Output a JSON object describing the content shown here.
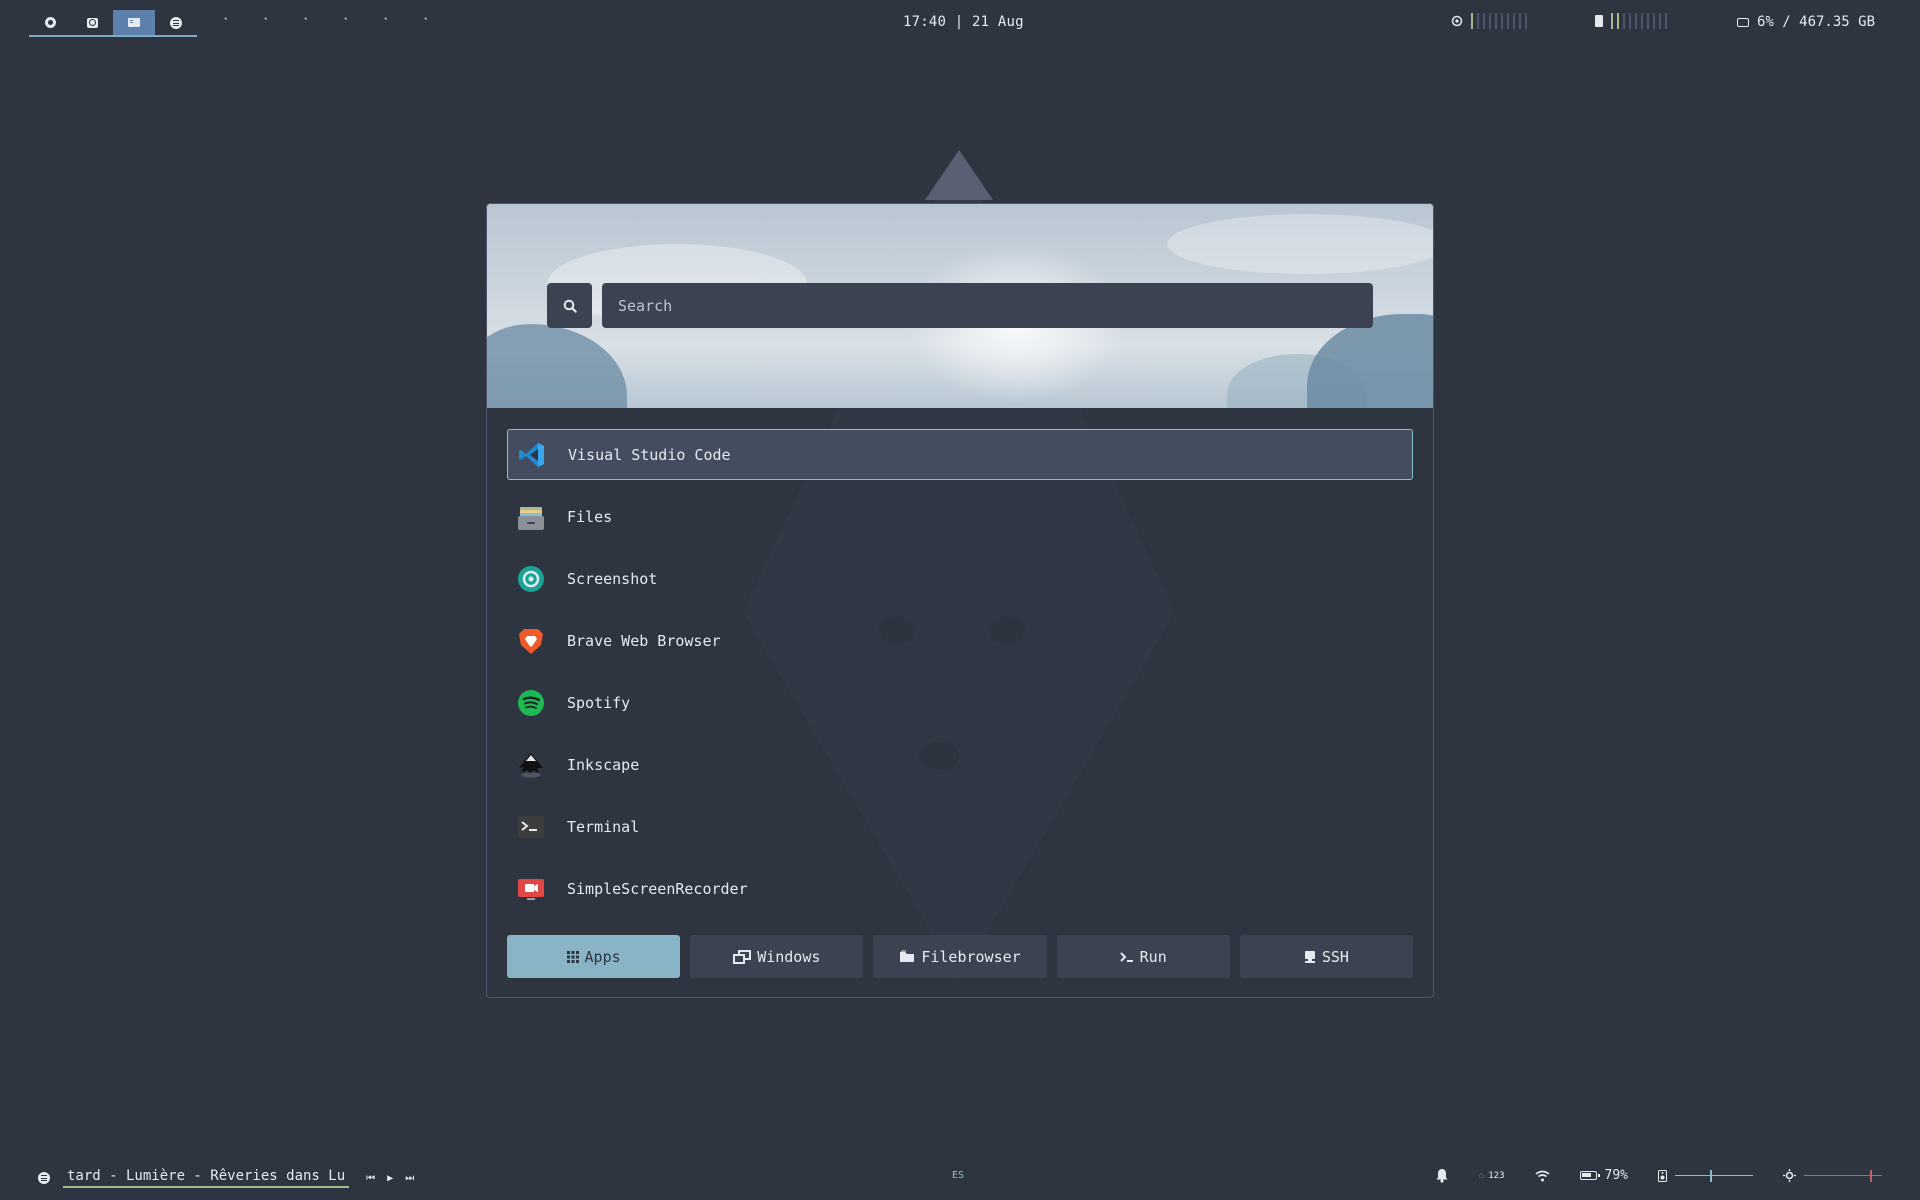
{
  "topbar": {
    "workspaces": [
      {
        "icon": "browser-icon",
        "active": false
      },
      {
        "icon": "record-icon",
        "active": false
      },
      {
        "icon": "terminal-icon",
        "active": true
      },
      {
        "icon": "spotify-icon",
        "active": false
      }
    ],
    "empty_workspaces": [
      "·",
      "·",
      "·",
      "·",
      "·",
      "·"
    ],
    "clock": "17:40 | 21 Aug",
    "cpu": {
      "icon": "cpu-icon",
      "level": 0.1
    },
    "memory": {
      "icon": "memory-icon",
      "level": 0.2
    },
    "disk": {
      "icon": "disk-icon",
      "text": "6% / 467.35 GB"
    }
  },
  "launcher": {
    "search": {
      "placeholder": "Search",
      "value": ""
    },
    "apps": [
      {
        "name": "Visual Studio Code",
        "icon": "vscode-icon",
        "selected": true
      },
      {
        "name": "Files",
        "icon": "files-icon",
        "selected": false
      },
      {
        "name": "Screenshot",
        "icon": "screenshot-icon",
        "selected": false
      },
      {
        "name": "Brave Web Browser",
        "icon": "brave-icon",
        "selected": false
      },
      {
        "name": "Spotify",
        "icon": "spotify-icon",
        "selected": false
      },
      {
        "name": "Inkscape",
        "icon": "inkscape-icon",
        "selected": false
      },
      {
        "name": "Terminal",
        "icon": "terminal-icon",
        "selected": false
      },
      {
        "name": "SimpleScreenRecorder",
        "icon": "screen-recorder-icon",
        "selected": false
      }
    ],
    "tabs": [
      {
        "label": "Apps",
        "icon": "grid-icon",
        "active": true
      },
      {
        "label": "Windows",
        "icon": "windows-icon",
        "active": false
      },
      {
        "label": "Filebrowser",
        "icon": "folder-icon",
        "active": false
      },
      {
        "label": "Run",
        "icon": "run-icon",
        "active": false
      },
      {
        "label": "SSH",
        "icon": "ssh-icon",
        "active": false
      }
    ]
  },
  "bottombar": {
    "now_playing": "tard - Lumière - Rêveries dans Lu",
    "keyboard_layout": "ES",
    "numlock_label": "123",
    "battery": "79%",
    "volume_level": 0.45,
    "brightness_level": 0.85,
    "colors": {
      "volume": "#88c0d0",
      "brightness": "#bf616a",
      "accent": "#88c0d0",
      "active_tab": "#88b4c6"
    }
  }
}
